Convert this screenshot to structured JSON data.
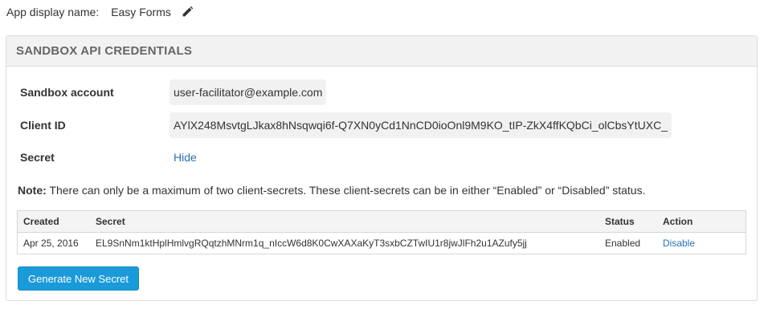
{
  "app": {
    "label": "App display name:",
    "value": "Easy Forms",
    "edit_icon": "pencil-icon"
  },
  "panel": {
    "title": "SANDBOX API CREDENTIALS",
    "fields": {
      "sandbox_account": {
        "label": "Sandbox account",
        "value": "user-facilitator@example.com"
      },
      "client_id": {
        "label": "Client ID",
        "value": "AYlX248MsvtgLJkax8hNsqwqi6f-Q7XN0yCd1NnCD0ioOnl9M9KO_tIP-ZkX4ffKQbCi_olCbsYtUXC_"
      },
      "secret": {
        "label": "Secret",
        "link": "Hide"
      }
    },
    "note": {
      "bold": "Note:",
      "text": " There can only be a maximum of two client-secrets. These client-secrets can be in either “Enabled” or “Disabled” status."
    },
    "table": {
      "headers": {
        "created": "Created",
        "secret": "Secret",
        "status": "Status",
        "action": "Action"
      },
      "rows": [
        {
          "created": "Apr 25, 2016",
          "secret": "EL9SnNm1ktHplHmlvgRQqtzhMNrm1q_nIccW6d8K0CwXAXaKyT3sxbCZTwIU1r8jwJlFh2u1AZufy5jj",
          "status": "Enabled",
          "action": "Disable"
        }
      ]
    },
    "generate_button": "Generate New Secret"
  },
  "colors": {
    "link": "#2472b7",
    "primary_button": "#1a9ad9",
    "panel_header_bg": "#f2f2f2"
  }
}
